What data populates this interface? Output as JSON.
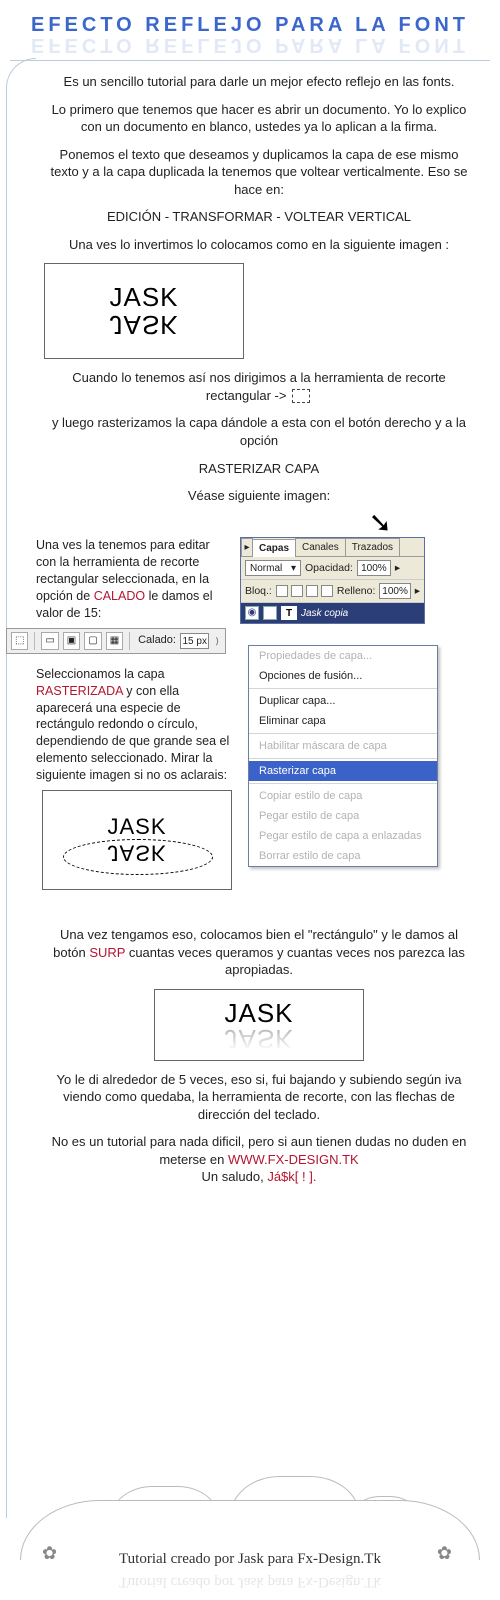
{
  "title": "EFECTO REFLEJO PARA LA FONT",
  "intro1": "Es un sencillo tutorial para darle un mejor efecto reflejo en las fonts.",
  "intro2": "Lo primero que tenemos que hacer es abrir un documento. Yo lo explico con un documento en blanco, ustedes ya lo aplican a la firma.",
  "intro3": "Ponemos el texto que deseamos y duplicamos la capa de ese mismo texto y a la capa duplicada la tenemos que voltear verticalmente. Eso se hace en:",
  "menu_path": "EDICIÓN - TRANSFORMAR - VOLTEAR VERTICAL",
  "intro4": "Una ves lo invertimos lo colocamos como en la siguiente imagen :",
  "sample_word": "JASK",
  "step2a": "Cuando lo tenemos así nos dirigimos a la herramienta de recorte rectangular ->",
  "step2b": "y luego rasterizamos la capa dándole a esta con el botón derecho y a la opción",
  "rasterize_label": "RASTERIZAR CAPA",
  "step2c": "Véase siguiente imagen:",
  "left_para1": "Una ves la tenemos para editar con la herramienta de recorte rectangular seleccionada, en la opción de ",
  "calado_word": "CALADO",
  "left_para1b": " le damos el valor de 15:",
  "calado_bar": {
    "label": "Calado:",
    "value": "15 px"
  },
  "left_para2a": "Seleccionamos la capa ",
  "rasterizada_word": "RASTERIZADA",
  "left_para2b": " y con ella aparecerá una especie de rectángulo redondo o círculo, dependiendo de que grande sea el elemento seleccionado. Mirar la siguiente imagen si no os aclarais:",
  "panel": {
    "tabs": [
      "Capas",
      "Canales",
      "Trazados"
    ],
    "mode": "Normal",
    "opacity_label": "Opacidad:",
    "opacity_value": "100%",
    "lock_label": "Bloq.:",
    "fill_label": "Relleno:",
    "fill_value": "100%",
    "layer_name": "Jask copia"
  },
  "ctx_menu": {
    "items": [
      {
        "label": "Propiedades de capa...",
        "disabled": true
      },
      {
        "label": "Opciones de fusión...",
        "disabled": false
      },
      {
        "label": "Duplicar capa...",
        "disabled": false
      },
      {
        "label": "Eliminar capa",
        "disabled": false
      },
      {
        "label": "Habilitar máscara de capa",
        "disabled": true
      },
      {
        "label": "Rasterizar capa",
        "selected": true
      },
      {
        "label": "Copiar estilo de capa",
        "disabled": true
      },
      {
        "label": "Pegar estilo de capa",
        "disabled": true
      },
      {
        "label": "Pegar estilo de capa a enlazadas",
        "disabled": true
      },
      {
        "label": "Borrar estilo de capa",
        "disabled": true
      }
    ]
  },
  "step3a": "Una vez tengamos eso, colocamos bien el \"rectángulo\" y le damos al botón ",
  "surp": "SURP",
  "step3b": " cuantas veces queramos y cuantas veces nos parezca las apropiadas.",
  "outro1": "Yo le di alrededor de 5 veces, eso si, fui bajando y subiendo según iva viendo como quedaba, la herramienta de recorte, con las flechas de dirección del teclado.",
  "outro2a": "No es un tutorial para nada dificil, pero si aun tienen dudas no duden en meterse en ",
  "site": "WWW.FX-DESIGN.TK",
  "outro2b": "Un saludo, ",
  "signature": "Já$k[ ! ].",
  "footer": "Tutorial creado por Jask para Fx-Design.Tk"
}
